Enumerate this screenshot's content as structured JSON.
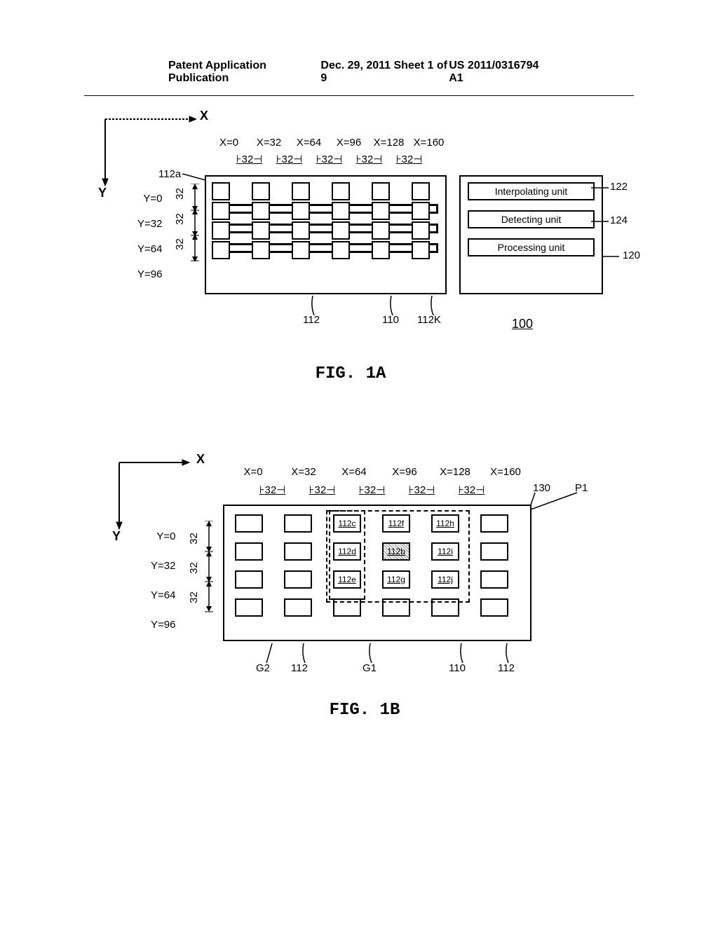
{
  "header": {
    "left": "Patent Application Publication",
    "center": "Dec. 29, 2011 Sheet 1 of 9",
    "right": "US 2011/0316794 A1"
  },
  "figA": {
    "axisX": "X",
    "axisY": "Y",
    "xLabels": [
      "X=0",
      "X=32",
      "X=64",
      "X=96",
      "X=128",
      "X=160"
    ],
    "xPitches": [
      "32",
      "32",
      "32",
      "32",
      "32"
    ],
    "yLabels": [
      "Y=0",
      "Y=32",
      "Y=64",
      "Y=96"
    ],
    "yPitches": [
      "32",
      "32",
      "32"
    ],
    "ref112a": "112a",
    "ref112": "112",
    "ref110": "110",
    "ref112K": "112K",
    "units": {
      "interp": "Interpolating unit",
      "detect": "Detecting unit",
      "process": "Processing unit"
    },
    "ref122": "122",
    "ref124": "124",
    "ref120": "120",
    "deviceNum": "100",
    "label": "FIG. 1A"
  },
  "figB": {
    "axisX": "X",
    "axisY": "Y",
    "xLabels": [
      "X=0",
      "X=32",
      "X=64",
      "X=96",
      "X=128",
      "X=160"
    ],
    "xPitches": [
      "32",
      "32",
      "32",
      "32",
      "32"
    ],
    "yLabels": [
      "Y=0",
      "Y=32",
      "Y=64",
      "Y=96"
    ],
    "yPitches": [
      "32",
      "32",
      "32"
    ],
    "nodeLabels": {
      "n112c": "112c",
      "n112d": "112d",
      "n112e": "112e",
      "n112f": "112f",
      "n112b": "112b",
      "n112g": "112g",
      "n112h": "112h",
      "n112i": "112i",
      "n112j": "112j"
    },
    "ref130": "130",
    "refP1": "P1",
    "refG2": "G2",
    "ref112": "112",
    "refG1": "G1",
    "ref110": "110",
    "ref112b": "112",
    "label": "FIG. 1B"
  }
}
